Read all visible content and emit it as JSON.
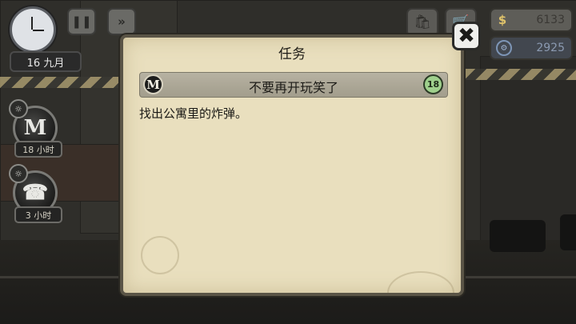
{
  "hud": {
    "date": "16 九月",
    "pause_icon": "pause-icon",
    "fast_forward_icon": "fast-forward-icon",
    "bag_icon": "bag-icon",
    "cart_icon": "cart-icon",
    "cash_symbol": "$",
    "cash_value": "6133",
    "parts_value": "2925"
  },
  "side_tasks": [
    {
      "icon": "M",
      "time": "18 小时"
    },
    {
      "icon": "☎",
      "time": "3 小时"
    }
  ],
  "dialog": {
    "title": "任务",
    "quest": {
      "icon": "M",
      "title": "不要再开玩笑了",
      "badge": "18",
      "description": "找出公寓里的炸弹。"
    },
    "close_icon": "close-icon"
  },
  "colors": {
    "parchment": "#e9dfbe",
    "quest_badge": "#9fd08c",
    "cash_accent": "#e1c46b",
    "parts_accent": "#9fb4d2"
  }
}
